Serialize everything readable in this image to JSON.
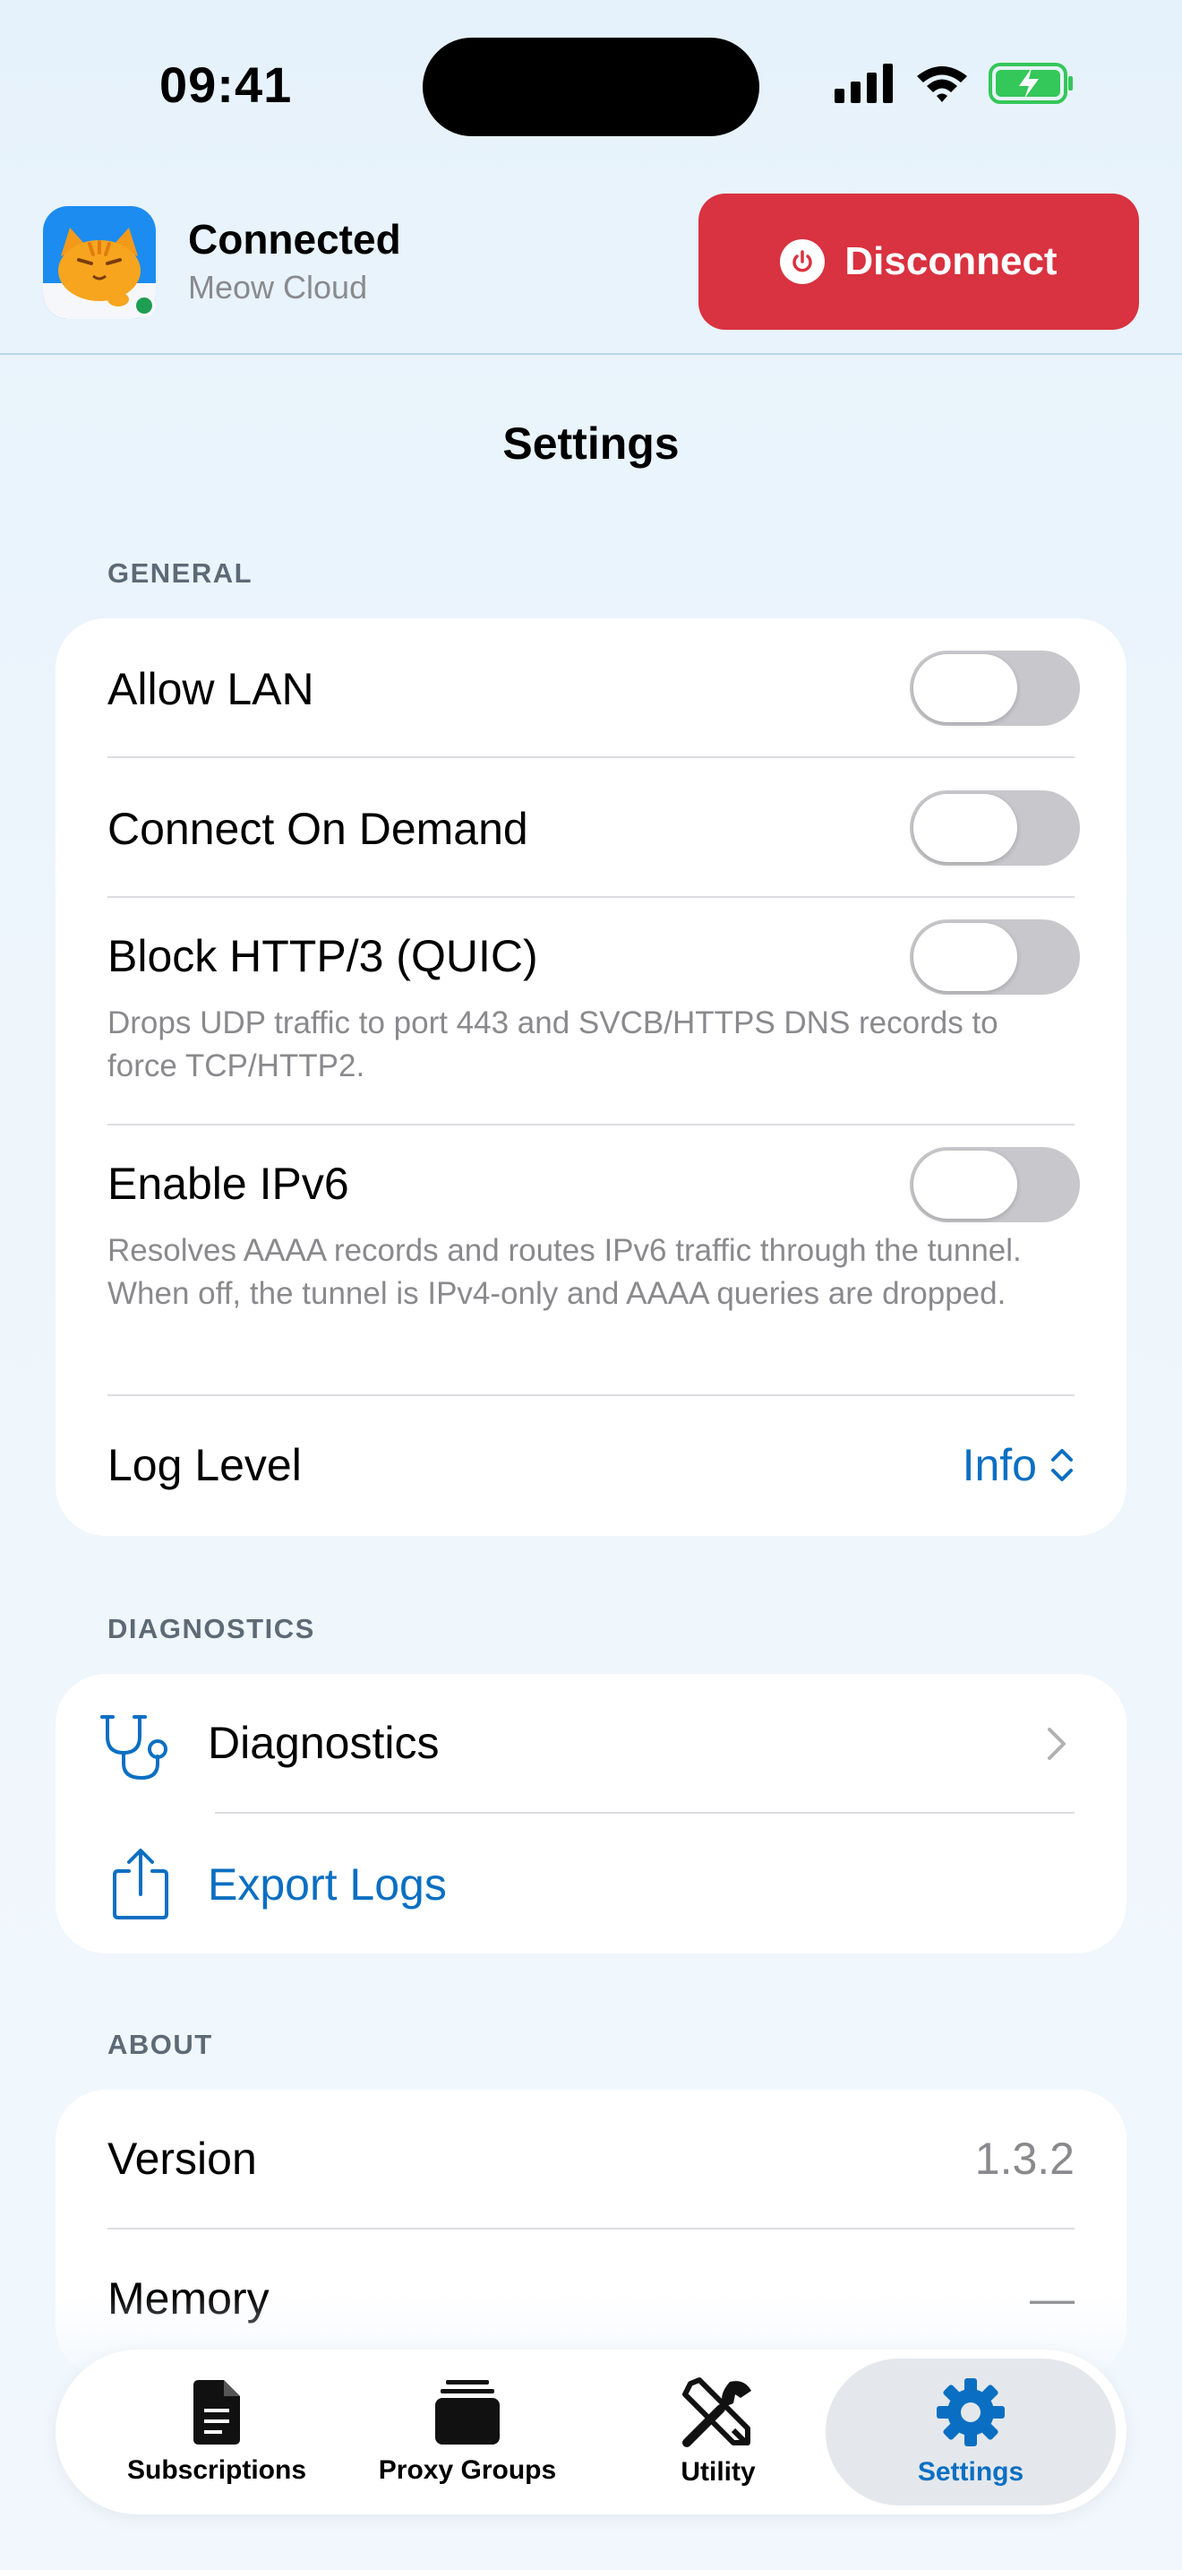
{
  "status_bar": {
    "time": "09:41"
  },
  "connection": {
    "status": "Connected",
    "profile": "Meow Cloud",
    "disconnect_label": "Disconnect"
  },
  "page": {
    "title": "Settings"
  },
  "general": {
    "header": "GENERAL",
    "allow_lan": {
      "label": "Allow LAN",
      "enabled": false
    },
    "connect_on_demand": {
      "label": "Connect On Demand",
      "enabled": false
    },
    "block_http3": {
      "label": "Block HTTP/3 (QUIC)",
      "description": "Drops UDP traffic to port 443 and SVCB/HTTPS DNS records to force TCP/HTTP2.",
      "enabled": false
    },
    "enable_ipv6": {
      "label": "Enable IPv6",
      "description": "Resolves AAAA records and routes IPv6 traffic through the tunnel. When off, the tunnel is IPv4-only and AAAA queries are dropped.",
      "enabled": false
    },
    "log_level": {
      "label": "Log Level",
      "value": "Info"
    }
  },
  "diagnostics": {
    "header": "DIAGNOSTICS",
    "diagnostics_label": "Diagnostics",
    "export_logs_label": "Export Logs"
  },
  "about": {
    "header": "ABOUT",
    "version_label": "Version",
    "version_value": "1.3.2",
    "memory_label": "Memory",
    "memory_value": "—"
  },
  "tabs": [
    {
      "label": "Subscriptions",
      "icon": "document-icon"
    },
    {
      "label": "Proxy Groups",
      "icon": "stack-icon"
    },
    {
      "label": "Utility",
      "icon": "tools-icon"
    },
    {
      "label": "Settings",
      "icon": "gear-icon",
      "active": true
    }
  ],
  "colors": {
    "accent": "#0a6fc2",
    "disconnect": "#d93240",
    "connected_dot": "#1e9e52",
    "battery": "#34c759"
  }
}
